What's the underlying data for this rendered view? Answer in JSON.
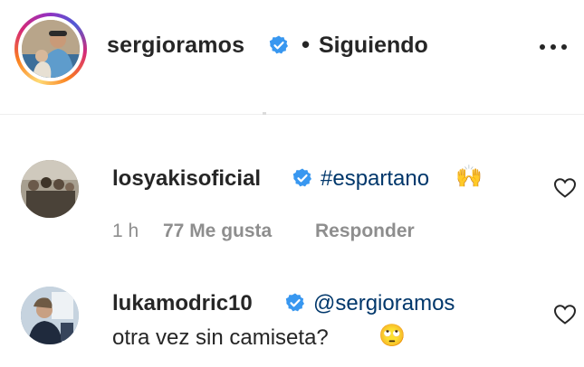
{
  "header": {
    "username": "sergioramos",
    "separator": "•",
    "follow_status": "Siguiendo",
    "avatar_icon": "profile-photo",
    "more_icon": "more-horizontal-icon",
    "verified_icon": "verified-badge-icon"
  },
  "comments": [
    {
      "username": "losyakisoficial",
      "verified": true,
      "hashtag": "#espartano",
      "emoji": "🙌",
      "time": "1 h",
      "likes": "77 Me gusta",
      "reply_label": "Responder",
      "heart_icon": "heart-outline-icon"
    },
    {
      "username": "lukamodric10",
      "verified": true,
      "mention": "@sergioramos",
      "text": "otra vez sin camiseta?",
      "emoji": "🙄",
      "heart_icon": "heart-outline-icon"
    }
  ],
  "colors": {
    "text": "#262626",
    "secondary": "#8e8e8e",
    "link": "#00376b",
    "verified": "#3897f0"
  }
}
